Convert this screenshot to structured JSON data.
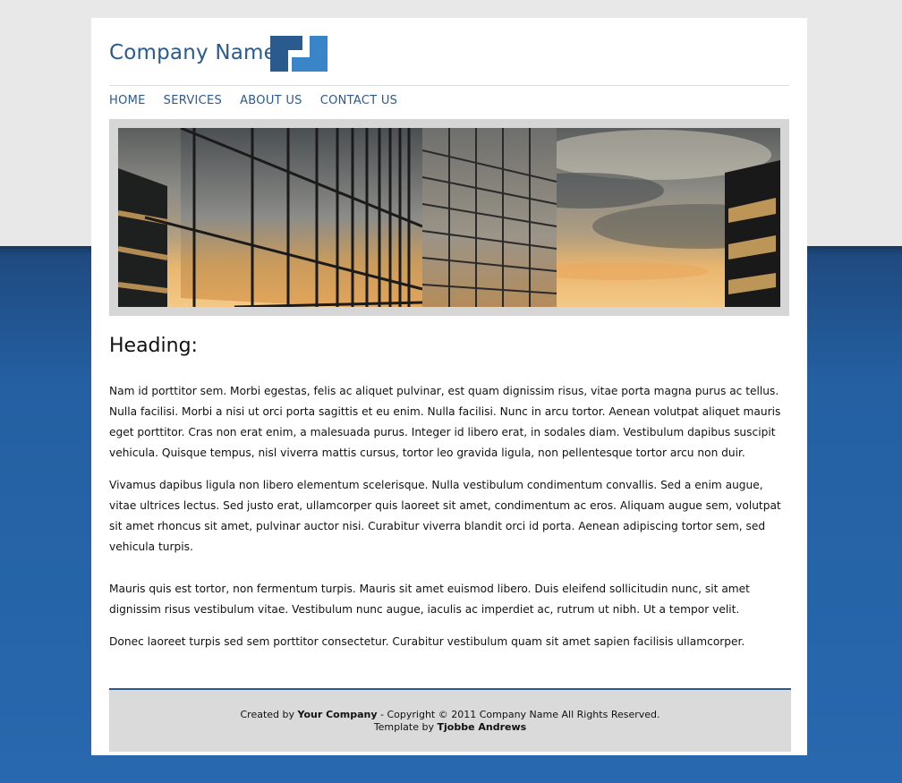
{
  "header": {
    "logo_text": "Company Name"
  },
  "nav": {
    "items": [
      "HOME",
      "SERVICES",
      "ABOUT US",
      "CONTACT US"
    ]
  },
  "main": {
    "heading": "Heading:",
    "paragraphs": [
      "Nam id porttitor sem. Morbi egestas, felis ac aliquet pulvinar, est quam dignissim risus, vitae porta magna purus ac tellus. Nulla facilisi. Morbi a nisi ut orci porta sagittis et eu enim. Nulla facilisi. Nunc in arcu tortor. Aenean volutpat aliquet mauris eget porttitor. Cras non erat enim, a malesuada purus. Integer id libero erat, in sodales diam. Vestibulum dapibus suscipit vehicula. Quisque tempus, nisl viverra mattis cursus, tortor leo gravida ligula, non pellentesque tortor arcu non duir.",
      "Vivamus dapibus ligula non libero elementum scelerisque. Nulla vestibulum condimentum convallis. Sed a enim augue, vitae ultrices lectus. Sed justo erat, ullamcorper quis laoreet sit amet, condimentum ac eros. Aliquam augue sem, volutpat sit amet rhoncus sit amet, pulvinar auctor nisi. Curabitur viverra blandit orci id porta. Aenean adipiscing tortor sem, sed vehicula turpis.",
      "Mauris quis est tortor, non fermentum turpis. Mauris sit amet euismod libero. Duis eleifend sollicitudin nunc, sit amet dignissim risus vestibulum vitae. Vestibulum nunc augue, iaculis ac imperdiet ac, rutrum ut nibh. Ut a tempor velit.",
      "Donec laoreet turpis sed sem porttitor consectetur. Curabitur vestibulum quam sit amet sapien facilisis ullamcorper."
    ]
  },
  "footer": {
    "created_by": "Created by",
    "company": "Your Company",
    "copyright": "- Copyright © 2011 Company Name All Rights Reserved.",
    "template_by": "Template by",
    "author": "Tjobbe Andrews"
  },
  "colors": {
    "brand": "#2a5a8e",
    "logo_dark": "#2a5a8e",
    "logo_light": "#3a84c8",
    "background_blue": "#2868ae"
  },
  "icons": {
    "logo": "company-logo-icon"
  }
}
